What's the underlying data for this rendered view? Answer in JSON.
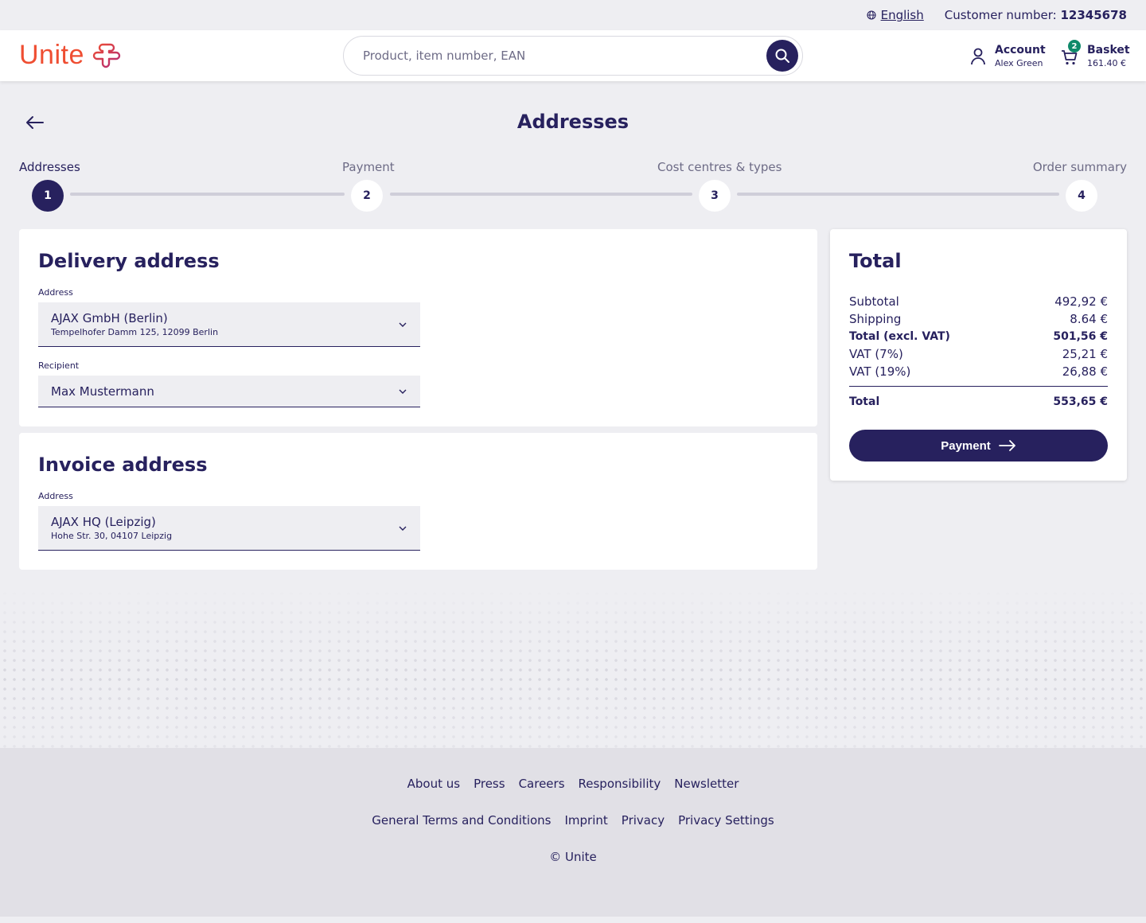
{
  "topbar": {
    "language": "English",
    "customer_label": "Customer number: ",
    "customer_number": "12345678"
  },
  "header": {
    "logo_text": "Unite",
    "search_placeholder": "Product, item number, EAN",
    "account_title": "Account",
    "account_user": "Alex Green",
    "basket_title": "Basket",
    "basket_amount": "161.40 €",
    "basket_count": "2"
  },
  "page": {
    "title": "Addresses"
  },
  "steps": [
    {
      "label": "Addresses",
      "number": "1"
    },
    {
      "label": "Payment",
      "number": "2"
    },
    {
      "label": "Cost centres & types",
      "number": "3"
    },
    {
      "label": "Order summary",
      "number": "4"
    }
  ],
  "delivery": {
    "title": "Delivery address",
    "address_label": "Address",
    "address_main": "AJAX GmbH (Berlin)",
    "address_sub": "Tempelhofer Damm 125, 12099 Berlin",
    "recipient_label": "Recipient",
    "recipient_value": "Max Mustermann"
  },
  "invoice": {
    "title": "Invoice address",
    "address_label": "Address",
    "address_main": "AJAX HQ (Leipzig)",
    "address_sub": "Hohe Str. 30, 04107 Leipzig"
  },
  "total": {
    "title": "Total",
    "rows": [
      {
        "label": "Subtotal",
        "value": "492,92 €"
      },
      {
        "label": "Shipping",
        "value": "8.64 €"
      },
      {
        "label": "Total (excl. VAT)",
        "value": "501,56 €"
      },
      {
        "label": "VAT (7%)",
        "value": "25,21 €"
      },
      {
        "label": "VAT (19%)",
        "value": "26,88 €"
      }
    ],
    "grand_label": "Total",
    "grand_value": "553,65 €",
    "button_label": "Payment"
  },
  "footer": {
    "row1": [
      "About us",
      "Press",
      "Careers",
      "Responsibility",
      "Newsletter"
    ],
    "row2": [
      "General Terms and Conditions",
      "Imprint",
      "Privacy",
      "Privacy Settings"
    ],
    "copyright": "© Unite"
  },
  "colors": {
    "primary": "#27215e",
    "brand": "#ef4e32",
    "badge": "#0f8a6a",
    "background": "#eeeef2"
  }
}
